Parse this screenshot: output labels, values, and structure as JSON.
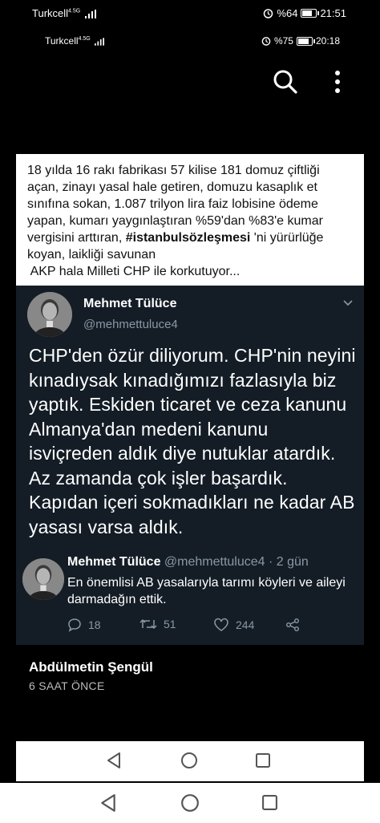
{
  "status_outer": {
    "carrier": "Turkcell",
    "network": "4.5G",
    "battery": "%64",
    "time": "21:51"
  },
  "status_inner": {
    "carrier": "Turkcell",
    "network": "4.5G",
    "battery": "%75",
    "time": "20:18"
  },
  "toolbar": {
    "search_icon": "search-icon",
    "more_icon": "more-vertical-icon"
  },
  "caption": {
    "lines": [
      "18 yılda 16 rakı fabrikası 57 kilise 181 domuz çiftliği",
      "açan, zinayı yasal hale getiren, domuzu kasaplık et",
      "sınıfına sokan, 1.087 trilyon lira faiz lobisine ödeme",
      "yapan, kumarı yaygınlaştıran %59'dan %83'e kumar",
      "vergisini arttıran, ",
      "#istanbulsözleşmesi",
      " 'ni yürürlüğe",
      "koyan, laikliği savunan",
      " AKP hala Milleti CHP ile korkutuyor..."
    ]
  },
  "tweet": {
    "name": "Mehmet Tülüce",
    "handle": "@mehmettuluce4",
    "body": "CHP'den özür diliyorum. CHP'nin neyini kınadıysak kınadığımızı fazlasıyla biz yaptık. Eskiden ticaret ve  ceza kanunu Almanya'dan medeni kanunu isviçreden aldık diye nutuklar atardık. Az zamanda çok işler başardık. Kapıdan içeri sokmadıkları ne kadar AB yasası varsa aldık.",
    "reply": {
      "name": "Mehmet Tülüce",
      "handle_time": "@mehmettuluce4 · 2 gün",
      "text": "En önemlisi AB yasalarıyla tarımı köyleri ve aileyi darmadağın ettik."
    },
    "actions": {
      "replies": "18",
      "retweets": "51",
      "likes": "244"
    }
  },
  "post": {
    "author": "Abdülmetin Şengül",
    "time_ago": "6 SAAT ÖNCE"
  },
  "colors": {
    "card_bg": "#141d26",
    "muted": "#8899a6",
    "background": "#000000"
  }
}
